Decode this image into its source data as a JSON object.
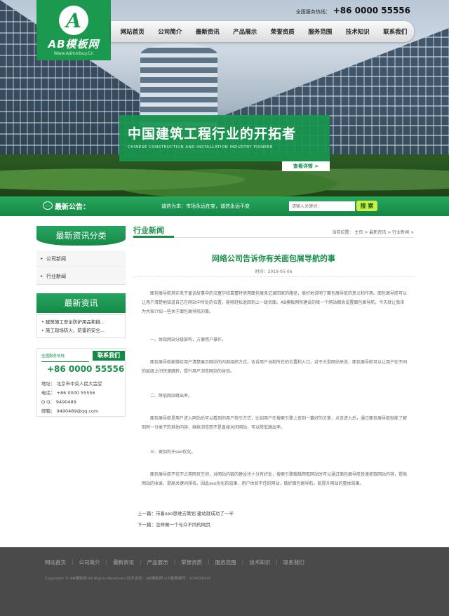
{
  "header": {
    "logo_letter": "A",
    "logo_text": "AB模板网",
    "logo_url": "Www.Adminbuy.Cn",
    "hotline_label": "全国服务热线：",
    "hotline_number": "+86 0000 55556"
  },
  "nav": {
    "items": [
      "网站首页",
      "公司简介",
      "最新资讯",
      "产品展示",
      "荣誉资质",
      "服务范围",
      "技术知识",
      "联系我们"
    ]
  },
  "banner": {
    "slogan_cn": "中国建筑工程行业的开拓者",
    "slogan_en": "CHINESE CONSTRUCTION AND INSTALLATION INDUSTRY PIONEER",
    "more_label": "查看详情 >"
  },
  "notice": {
    "label": "最新公告：",
    "text": "诚信为本：市场永远在变，诚信永远不变",
    "search_placeholder": "请输入关键词：",
    "search_button": "搜 索"
  },
  "sidebar": {
    "category_title": "最新资讯分类",
    "categories": [
      "公司新闻",
      "行业新闻"
    ],
    "news_title": "最新资讯",
    "news_items": [
      "建筑施工安全防护用品和措...",
      "施工现场防火、防雷的安全..."
    ],
    "contact": {
      "small_label": "全国服务热线",
      "tab_label": "联系我们",
      "phone": "+86 0000 55556",
      "address": "地址： 北京市中央人民大会堂",
      "tel": "电话： +86 0000 55556",
      "qq": "Q Q： 9490489",
      "email": "邮箱： 9490489@qq.com"
    }
  },
  "main": {
    "section_title": "行业新闻",
    "breadcrumb": "当前位置： 主页 > 最新资讯 > 行业新闻 >",
    "article_title": "网络公司告诉你有关面包屑导航的事",
    "article_meta": "时间：2019-05-06",
    "paragraphs": [
      "面包屑导航其实来于童话故事中的汉塞尔和葛蕾特使用面包屑来记录回家的路径，很好地说明了面包屑导航的意义和作用。面包屑导航可以让用户清楚地知道自己在网站中所处的位置，能够轻松返回到上一级页面。AB模板网所建设的每一个网站都会设置面包屑导航，今天就让我来为大家介绍一些关于面包屑导航的事。",
      "一、体现网站分级架构，方便用户操作。",
      "面包屑导航能够给用户清楚展示网站的内部组织方式，告诉用户当前所在的位置和入口。对于大型网站来说，面包屑导航可以让用户在不同的层级之间快速跳转，提升用户浏览网站的体验。",
      "二、降低网站跳出率。",
      "面包屑导航是用户进入网站后可以看到的用户指引方式，比如用户在搜索引擎上查到一篇好的文章，点击进入后，通过面包屑导航就能了解到同一分类下的其他内容，继续浏览而不是直接关闭网站，可以降低跳出率。",
      "三、更加利于seo优化。",
      "面包屑导航不仅不占用网页空间，对网站内链的建设也十分有好处，搜索引擎蜘蛛爬取网站时可以通过面包屑导航快速抓取网站内容，提高网站的收录，提高关键词排名。因此seo优化的效果，用户体验不佳的网站，做好面包屑导航，能提升网站的整体效果。"
    ],
    "prev": "上一篇：带着seo思维去策划 建站就成功了一半",
    "next": "下一篇：怎样做一个与众不同的网页"
  },
  "footer": {
    "links": [
      "网站首页",
      "公司简介",
      "最新资讯",
      "产品展示",
      "荣誉资质",
      "服务范围",
      "技术知识",
      "联系我们"
    ],
    "copyright": "Copyright © AB模板网 All Rights Reserved   技术支持：AB模板网 ICP备案编号：ICP000000"
  }
}
